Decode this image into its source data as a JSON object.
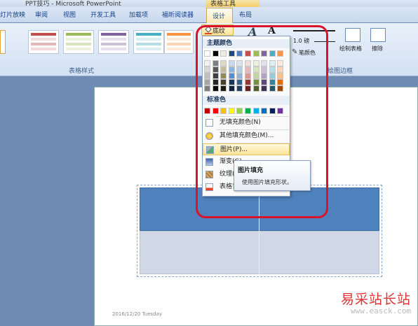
{
  "window": {
    "title": "PPT技巧 - Microsoft PowerPoint",
    "context_group": "表格工具"
  },
  "tabs": [
    "灯片放映",
    "审阅",
    "视图",
    "开发工具",
    "加载项",
    "福昕阅读器",
    "设计",
    "布局"
  ],
  "active_tab": "设计",
  "ribbon": {
    "group_table_styles": "表格样式",
    "group_draw_borders": "绘图边框",
    "shading_label": "底纹",
    "pen_weight": "1.0 磅",
    "pen_color": "笔颜色",
    "draw_table": "绘制表格",
    "eraser": "擦除"
  },
  "menu": {
    "theme_colors_header": "主题颜色",
    "standard_colors_header": "标准色",
    "theme_colors_top": [
      "#ffffff",
      "#000000",
      "#eeece1",
      "#1f497d",
      "#4f81bd",
      "#c0504d",
      "#9bbb59",
      "#8064a2",
      "#4bacc6",
      "#f79646"
    ],
    "theme_colors_shades": [
      [
        "#f2f2f2",
        "#7f7f7f",
        "#ddd9c3",
        "#c6d9f0",
        "#dbe5f1",
        "#f2dcdb",
        "#ebf1dd",
        "#e5e0ec",
        "#dbeef3",
        "#fdeada"
      ],
      [
        "#d8d8d8",
        "#595959",
        "#c4bd97",
        "#8db3e2",
        "#b8cce4",
        "#e5b9b7",
        "#d7e3bc",
        "#ccc1d9",
        "#b7dde8",
        "#fbd5b5"
      ],
      [
        "#bfbfbf",
        "#3f3f3f",
        "#938953",
        "#548dd4",
        "#95b3d7",
        "#d99694",
        "#c3d69b",
        "#b2a2c7",
        "#92cddc",
        "#fac08f"
      ],
      [
        "#a5a5a5",
        "#262626",
        "#494429",
        "#17365d",
        "#366092",
        "#953734",
        "#76923c",
        "#5f497a",
        "#31859b",
        "#e36c09"
      ],
      [
        "#7f7f7f",
        "#0c0c0c",
        "#1d1b10",
        "#0f243e",
        "#244061",
        "#632423",
        "#4f6128",
        "#3f3151",
        "#205867",
        "#974806"
      ]
    ],
    "standard_colors": [
      "#c00000",
      "#ff0000",
      "#ffc000",
      "#ffff00",
      "#92d050",
      "#00b050",
      "#00b0f0",
      "#0070c0",
      "#002060",
      "#7030a0"
    ],
    "items": [
      "无填充颜色(N)",
      "其他填充颜色(M)...",
      "图片(P)...",
      "渐变(G)",
      "纹理(T)",
      "表格背景(B)"
    ]
  },
  "tooltip": {
    "title": "图片填充",
    "desc": "使用图片填充形状。"
  },
  "slide": {
    "footer_date": "2016/12/20 Tuesday"
  },
  "watermark": {
    "text": "易采站长站",
    "url": "www.easck.com"
  }
}
